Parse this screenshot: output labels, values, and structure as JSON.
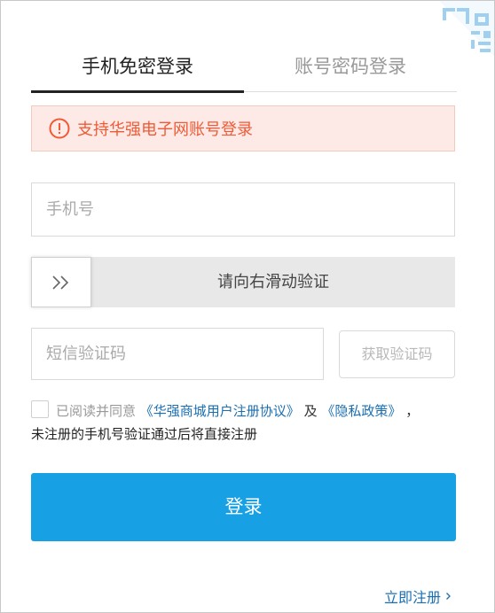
{
  "tabs": [
    {
      "label": "手机免密登录",
      "active": true
    },
    {
      "label": "账号密码登录",
      "active": false
    }
  ],
  "notice": {
    "text": "支持华强电子网账号登录",
    "icon": "alert-circle-icon",
    "color": "#ef5b37"
  },
  "phone_field": {
    "placeholder": "手机号",
    "value": ""
  },
  "slider": {
    "text": "请向右滑动验证",
    "handle_icon": "double-chevron-right-icon",
    "progress": 0
  },
  "sms_field": {
    "placeholder": "短信验证码",
    "value": ""
  },
  "get_code_button": {
    "label": "获取验证码"
  },
  "agreement": {
    "checked": false,
    "prefix": "已阅读并同意",
    "terms_link": "《华强商城用户注册协议》",
    "connector": "及",
    "privacy_link": "《隐私政策》",
    "suffix": "，",
    "note": "未注册的手机号验证通过后将直接注册"
  },
  "login_button": {
    "label": "登录",
    "color": "#18a0e4"
  },
  "register_link": {
    "label": "立即注册",
    "icon": "chevron-right-icon"
  },
  "corner_icon": "qr-code-icon"
}
